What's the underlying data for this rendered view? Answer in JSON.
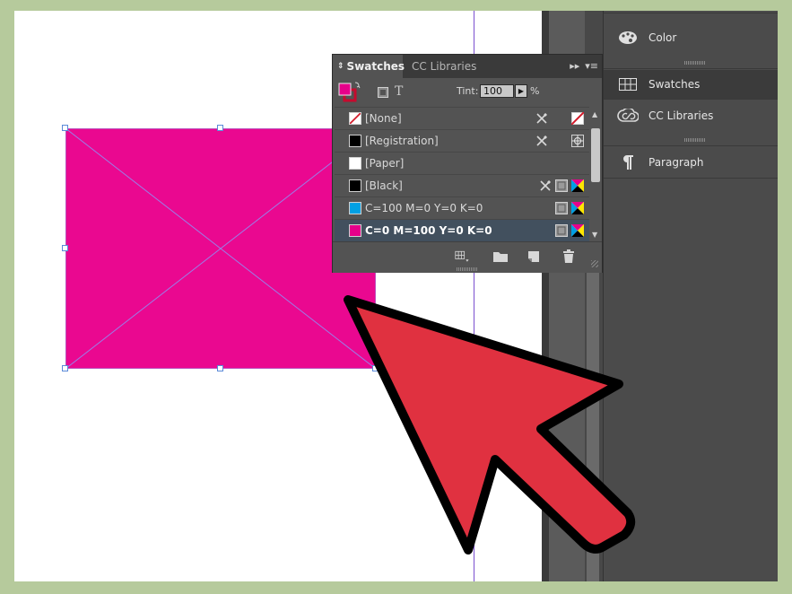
{
  "dock": {
    "items": [
      {
        "label": "Color",
        "icon": "palette-icon"
      },
      {
        "label": "Swatches",
        "icon": "swatches-grid-icon"
      },
      {
        "label": "CC Libraries",
        "icon": "creative-cloud-icon"
      },
      {
        "label": "Paragraph",
        "icon": "pilcrow-icon"
      }
    ]
  },
  "swatches_panel": {
    "tabs": [
      {
        "label": "Swatches"
      },
      {
        "label": "CC Libraries"
      }
    ],
    "tint_label": "Tint:",
    "tint_value": "100",
    "tint_unit": "%",
    "text_icon": "T",
    "fill_color": "#e6008a",
    "rows": [
      {
        "name": "[None]",
        "color": "none"
      },
      {
        "name": "[Registration]",
        "color": "#000000"
      },
      {
        "name": "[Paper]",
        "color": "#ffffff"
      },
      {
        "name": "[Black]",
        "color": "#000000"
      },
      {
        "name": "C=100 M=0 Y=0 K=0",
        "color": "#00a0e3"
      },
      {
        "name": "C=0 M=100 Y=0 K=0",
        "color": "#e6008a",
        "selected": true
      }
    ]
  },
  "canvas": {
    "frame_fill": "#ea0890",
    "cursor_color": "#e03140"
  }
}
